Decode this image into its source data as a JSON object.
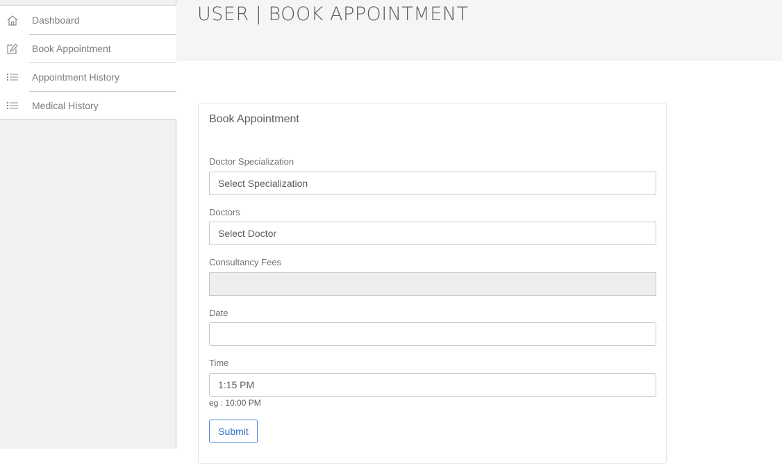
{
  "sidebar": {
    "items": [
      {
        "label": "Dashboard",
        "icon": "home-icon"
      },
      {
        "label": "Book Appointment",
        "icon": "pencil-square-icon"
      },
      {
        "label": "Appointment History",
        "icon": "list-icon"
      },
      {
        "label": "Medical History",
        "icon": "list-icon"
      }
    ]
  },
  "header": {
    "title": "USER | BOOK APPOINTMENT"
  },
  "form": {
    "panel_title": "Book Appointment",
    "specialization": {
      "label": "Doctor Specialization",
      "selected": "Select Specialization"
    },
    "doctor": {
      "label": "Doctors",
      "selected": "Select Doctor"
    },
    "fees": {
      "label": "Consultancy Fees",
      "value": ""
    },
    "date": {
      "label": "Date",
      "value": ""
    },
    "time": {
      "label": "Time",
      "value": "1:15 PM",
      "hint": "eg : 10:00 PM"
    },
    "submit_label": "Submit"
  },
  "colors": {
    "accent": "#2f6fcc",
    "sidebar_bg": "#f1f1f1",
    "header_bg": "#f5f5f5",
    "border": "#c8c7cc"
  }
}
